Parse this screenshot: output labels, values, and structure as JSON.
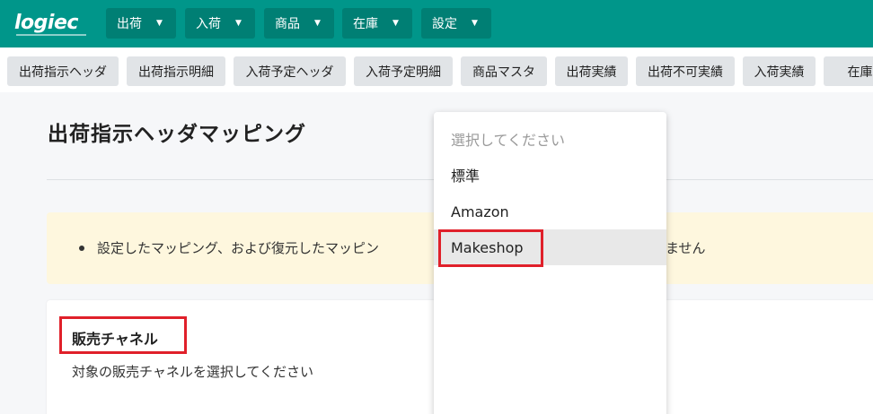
{
  "nav": {
    "logo": "logiec",
    "menus": [
      {
        "label": "出荷"
      },
      {
        "label": "入荷"
      },
      {
        "label": "商品"
      },
      {
        "label": "在庫"
      },
      {
        "label": "設定"
      }
    ],
    "caret_icon": "caret-down-icon"
  },
  "tabs": [
    "出荷指示ヘッダ",
    "出荷指示明細",
    "入荷予定ヘッダ",
    "入荷予定明細",
    "商品マスタ",
    "出荷実績",
    "出荷不可実績",
    "入荷実績",
    "在庫"
  ],
  "page": {
    "title": "出荷指示ヘッダマッピング",
    "notice_text": "設定したマッピング、および復元したマッピン",
    "notice_tail": "ません",
    "channel_label": "販売チャネル",
    "channel_help": "対象の販売チャネルを選択してください"
  },
  "dropdown": {
    "placeholder": "選択してください",
    "options": [
      "標準",
      "Amazon",
      "Makeshop"
    ],
    "highlighted": "Makeshop"
  },
  "colors": {
    "brand": "#00968a",
    "highlight_border": "#e0202a",
    "notice_bg": "#fef7de"
  }
}
